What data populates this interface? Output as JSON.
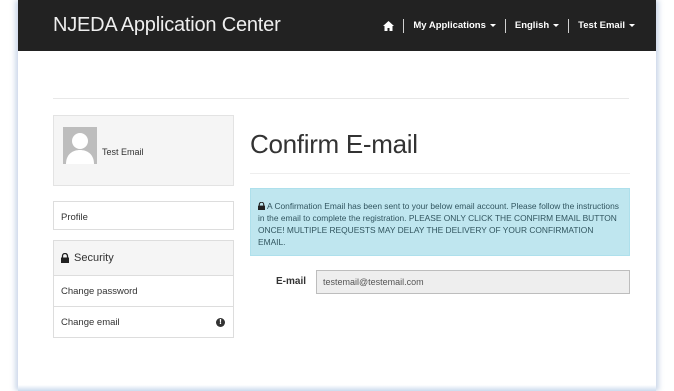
{
  "navbar": {
    "brand": "NJEDA Application Center",
    "items": [
      {
        "label": "My Applications"
      },
      {
        "label": "English"
      },
      {
        "label": "Test Email"
      }
    ]
  },
  "sidebar": {
    "user_name": "Test Email",
    "profile_link": "Profile",
    "security_heading": "Security",
    "items": [
      {
        "label": "Change password"
      },
      {
        "label": "Change email"
      }
    ]
  },
  "main": {
    "title": "Confirm E-mail",
    "alert_text": "A Confirmation Email has been sent to your below email account. Please follow the instructions in the email to complete the registration. PLEASE ONLY CLICK THE CONFIRM EMAIL BUTTON ONCE! MULTIPLE REQUESTS MAY DELAY THE DELIVERY OF YOUR CONFIRMATION EMAIL.",
    "email_label": "E-mail",
    "email_value": "testemail@testemail.com"
  },
  "colors": {
    "navbar_bg": "#222222",
    "alert_bg": "#bfe6ef",
    "alert_text": "#31555f"
  },
  "icons": [
    "home-icon",
    "caret-down-icon",
    "avatar-icon",
    "lock-icon",
    "info-icon"
  ]
}
